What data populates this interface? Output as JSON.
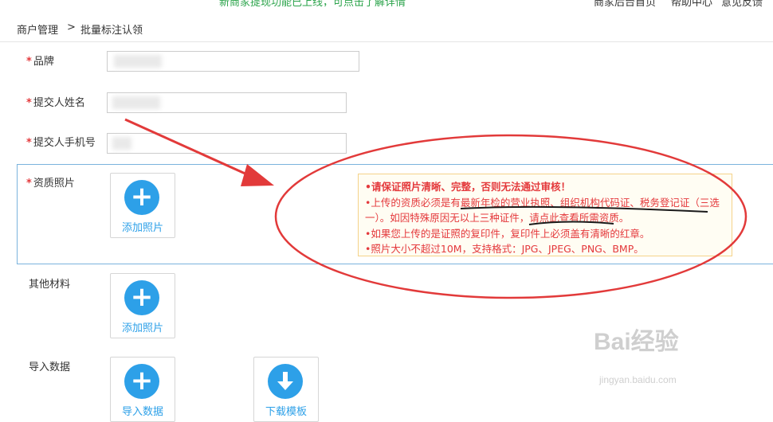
{
  "topbar": {
    "notice_fragment": "新商家提现功能已上线，可点击了解详情",
    "right_links": [
      "商家后台首页",
      "帮助中心",
      "意见反馈"
    ]
  },
  "breadcrumb": {
    "parent": "商户管理",
    "separator": ">",
    "current": "批量标注认领"
  },
  "form": {
    "required_mark": "*",
    "brand_label": "品牌",
    "submitter_name_label": "提交人姓名",
    "submitter_phone_label": "提交人手机号",
    "qualification_label": "资质照片",
    "other_materials_label": "其他材料",
    "import_data_label": "导入数据"
  },
  "uploads": {
    "add_photo": "添加照片",
    "import_data": "导入数据",
    "download_template": "下载模板"
  },
  "notice": {
    "line1": "•请保证照片清晰、完整，否则无法通过审核！",
    "line2": "•上传的资质必须是有最新年检的营业执照、组织机构代码证、税务登记证（三选一）。如因特殊原因无以上三种证件，请点此查看所需资质。",
    "line3": "•如果您上传的是证照的复印件，复印件上必须盖有清晰的红章。",
    "line4": "•照片大小不超过10M，支持格式：JPG、JPEG、PNG、BMP。"
  },
  "watermark": {
    "text": "Bai经验",
    "url": "jingyan.baidu.com"
  },
  "colors": {
    "accent": "#2da0e8",
    "required": "#e4393c",
    "annotation": "#e23a3a",
    "section_border": "#7ab3dd"
  }
}
